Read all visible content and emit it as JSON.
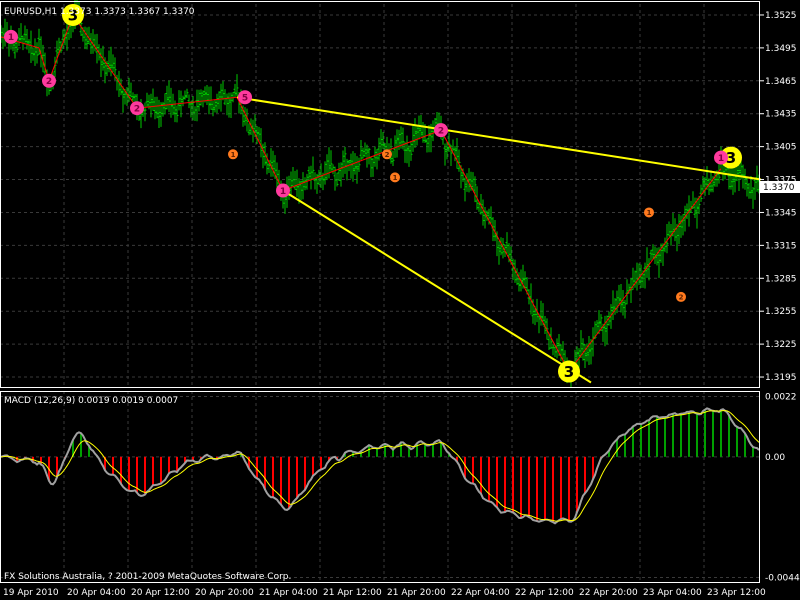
{
  "colors": {
    "background": "#000000",
    "grid": "#3a3a3a",
    "bar": "#00c800",
    "zigzag": "#ff0000",
    "trendline": "#ffff00",
    "wave_major": "#ffff00",
    "wave_minor": "#ff3a9e",
    "wave_small": "#ff7a1e",
    "hist_positive": "#00a000",
    "hist_negative": "#ff0000",
    "macd_line": "#a0a0a0",
    "signal_line": "#ffff00"
  },
  "price_panel": {
    "header": "EURUSD,H1  1.3373 1.3373 1.3367 1.3370",
    "ylim": [
      1.3185,
      1.3535
    ],
    "current_price": "1.3370"
  },
  "macd_panel": {
    "header": "MACD (12,26,9) 0.0019 0.0019 0.0007",
    "ylim": [
      -0.0046,
      0.0024
    ]
  },
  "footer": "FX Solutions Australia, ? 2001-2009 MetaQuotes Software Corp.",
  "chart_data": [
    {
      "type": "bar",
      "title": "EURUSD,H1  1.3373 1.3373 1.3367 1.3370",
      "y_ticks": [
        "1.3525",
        "1.3495",
        "1.3465",
        "1.3435",
        "1.3405",
        "1.3375",
        "1.3345",
        "1.3315",
        "1.3285",
        "1.3255",
        "1.3225",
        "1.3195"
      ],
      "x_ticks": [
        "19 Apr 2010",
        "20 Apr 04:00",
        "20 Apr 12:00",
        "20 Apr 20:00",
        "21 Apr 04:00",
        "21 Apr 12:00",
        "21 Apr 20:00",
        "22 Apr 04:00",
        "22 Apr 12:00",
        "22 Apr 20:00",
        "23 Apr 04:00",
        "23 Apr 12:00"
      ],
      "zigzag": [
        [
          0,
          1.3505
        ],
        [
          19,
          1.3495
        ],
        [
          24,
          1.3465
        ],
        [
          36,
          1.3525
        ],
        [
          68,
          1.344
        ],
        [
          118,
          1.345
        ],
        [
          141,
          1.3365
        ],
        [
          220,
          1.342
        ],
        [
          284,
          1.32
        ],
        [
          360,
          1.3385
        ]
      ],
      "trendlines": [
        {
          "from": [
            118,
            1.345
          ],
          "to": [
            380,
            1.3375
          ]
        },
        {
          "from": [
            141,
            1.3365
          ],
          "to": [
            295,
            1.319
          ]
        }
      ],
      "wave_labels": [
        {
          "x": 36,
          "y": 1.3525,
          "text": "3",
          "level": "major"
        },
        {
          "x": 284,
          "y": 1.32,
          "text": "3",
          "level": "major"
        },
        {
          "x": 365,
          "y": 1.3395,
          "text": "3",
          "level": "major"
        },
        {
          "x": 5,
          "y": 1.3505,
          "text": "1",
          "level": "minor"
        },
        {
          "x": 24,
          "y": 1.3465,
          "text": "2",
          "level": "minor"
        },
        {
          "x": 68,
          "y": 1.344,
          "text": "2",
          "level": "minor"
        },
        {
          "x": 122,
          "y": 1.345,
          "text": "5",
          "level": "minor"
        },
        {
          "x": 141,
          "y": 1.3365,
          "text": "1",
          "level": "minor"
        },
        {
          "x": 220,
          "y": 1.342,
          "text": "2",
          "level": "minor"
        },
        {
          "x": 360,
          "y": 1.3395,
          "text": "1",
          "level": "minor"
        },
        {
          "x": 116,
          "y": 1.3398,
          "text": "1",
          "level": "small"
        },
        {
          "x": 193,
          "y": 1.3398,
          "text": "2",
          "level": "small"
        },
        {
          "x": 197,
          "y": 1.3377,
          "text": "1",
          "level": "small"
        },
        {
          "x": 324,
          "y": 1.3345,
          "text": "1",
          "level": "small"
        },
        {
          "x": 340,
          "y": 1.3268,
          "text": "2",
          "level": "small"
        }
      ]
    },
    {
      "type": "bar",
      "title": "MACD (12,26,9) 0.0019 0.0019 0.0007",
      "y_ticks": [
        "0.0022",
        "0.00",
        "-0.0044"
      ]
    }
  ]
}
